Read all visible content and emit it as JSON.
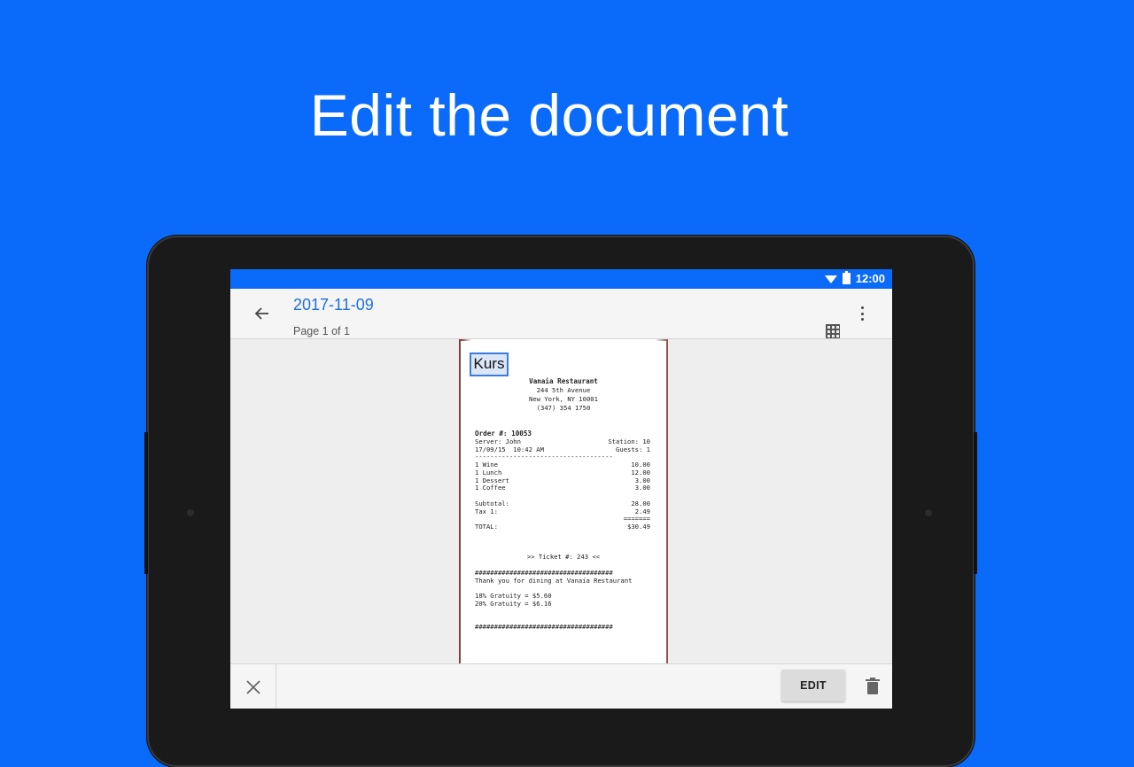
{
  "headline": "Edit the document",
  "status_bar": {
    "time": "12:00"
  },
  "app_bar": {
    "title": "2017-11-09",
    "subtitle": "Page 1 of 1",
    "back_icon": "arrow-back-icon",
    "more_icon": "more-vert-icon",
    "grid_icon": "grid-view-icon"
  },
  "ocr_selection": {
    "text": "Kurs"
  },
  "receipt": {
    "name": "Vanaia Restaurant",
    "address1": "244 5th Avenue",
    "address2": "New York, NY 10001",
    "phone": "(347) 354 1750",
    "order": "Order #: 10053",
    "server": "Server: John",
    "station": "Station: 10",
    "datetime": "17/09/15  10:42 AM",
    "guests": "Guests: 1",
    "separator": "------------------------------------",
    "items": [
      {
        "name": "1 Wine",
        "price": "10.00"
      },
      {
        "name": "1 Lunch",
        "price": "12.00"
      },
      {
        "name": "1 Dessert",
        "price": "3.00"
      },
      {
        "name": "1 Coffee",
        "price": "3.00"
      }
    ],
    "subtotal_label": "Subtotal:",
    "subtotal": "28.00",
    "tax_label": "Tax 1:",
    "tax": "2.49",
    "equals": "=======",
    "total_label": "TOTAL:",
    "total": "$30.49",
    "ticket": ">> Ticket #: 243 <<",
    "hash_line": "####################################",
    "thanks": "Thank you for dining at Vanaia Restaurant",
    "gratuity18": "18% Gratuity = $5.60",
    "gratuity20": "20% Gratuity = $6.16"
  },
  "bottom_bar": {
    "edit_label": "EDIT",
    "close_icon": "close-icon",
    "delete_icon": "trash-icon"
  },
  "colors": {
    "background": "#0a6bfb",
    "accent": "#1f6fe0",
    "tablet": "#1a1a1a"
  }
}
